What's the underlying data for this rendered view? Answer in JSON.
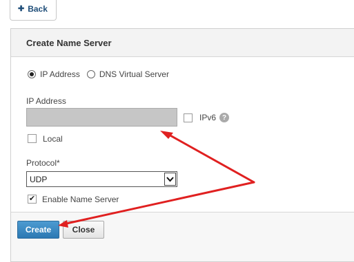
{
  "topbar": {
    "back_label": "Back",
    "back_icon": "arrow-left-icon"
  },
  "dialog": {
    "title": "Create Name Server"
  },
  "address_type": {
    "options": [
      {
        "label": "IP Address",
        "selected": true
      },
      {
        "label": "DNS Virtual Server",
        "selected": false
      }
    ]
  },
  "ip_address": {
    "label": "IP Address",
    "value": "",
    "ipv6_label": "IPv6",
    "help_icon": "?"
  },
  "local": {
    "label": "Local",
    "checked": false
  },
  "protocol": {
    "label": "Protocol*",
    "value": "UDP"
  },
  "enable": {
    "label": "Enable Name Server",
    "checked": true
  },
  "buttons": {
    "create": "Create",
    "close": "Close"
  },
  "colors": {
    "primary_button": "#2c79b3",
    "annotation_arrow": "#e02020",
    "input_redacted": "#c6c6c6"
  }
}
